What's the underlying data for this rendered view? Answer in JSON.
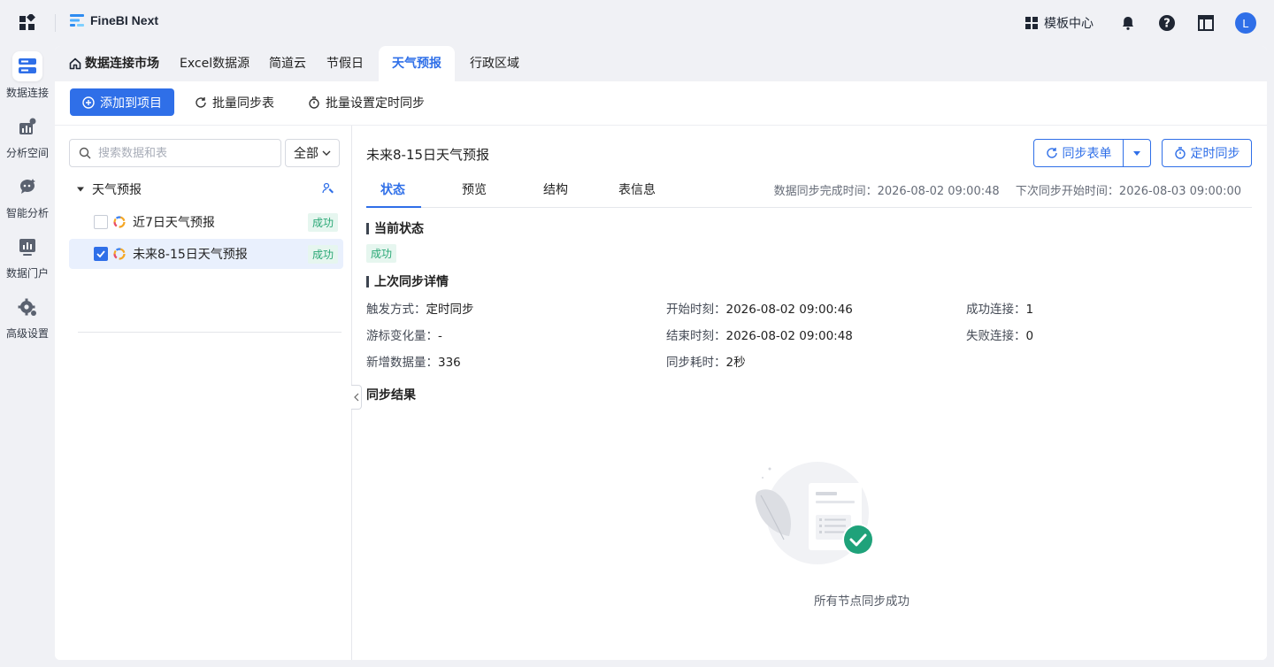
{
  "header": {
    "brand": "FineBI Next",
    "template_center": "模板中心",
    "avatar_letter": "L"
  },
  "leftnav": {
    "items": [
      {
        "label": "数据连接",
        "icon": "data-connection-icon",
        "active": true
      },
      {
        "label": "分析空间",
        "icon": "analysis-space-icon"
      },
      {
        "label": "智能分析",
        "icon": "smart-analysis-icon"
      },
      {
        "label": "数据门户",
        "icon": "data-portal-icon"
      },
      {
        "label": "高级设置",
        "icon": "advanced-settings-icon"
      }
    ]
  },
  "tabs": {
    "home": "数据连接市场",
    "items": [
      "Excel数据源",
      "简道云",
      "节假日",
      "天气预报",
      "行政区域"
    ],
    "active": "天气预报"
  },
  "toolbar": {
    "add_to_project": "添加到项目",
    "batch_sync": "批量同步表",
    "batch_schedule": "批量设置定时同步"
  },
  "tree": {
    "search_placeholder": "搜索数据和表",
    "filter_value": "全部",
    "root_label": "天气预报",
    "rows": [
      {
        "label": "近7日天气预报",
        "status": "成功",
        "checked": false
      },
      {
        "label": "未来8-15日天气预报",
        "status": "成功",
        "checked": true
      }
    ]
  },
  "detail": {
    "title": "未来8-15日天气预报",
    "sync_form_button": "同步表单",
    "timer_sync_button": "定时同步",
    "tabs": [
      "状态",
      "预览",
      "结构",
      "表信息"
    ],
    "sync_done_time": "数据同步完成时间：2026-08-02 09:00:48",
    "next_sync_time": "下次同步开始时间：2026-08-03 09:00:00",
    "current_status_title": "当前状态",
    "current_status": "成功",
    "last_sync_title": "上次同步详情",
    "trigger_label": "触发方式：",
    "trigger_value": "定时同步",
    "start_label": "开始时刻：",
    "start_value": "2026-08-02 09:00:46",
    "success_conn_label": "成功连接：",
    "success_conn_value": "1",
    "cursor_label": "游标变化量：",
    "cursor_value": "-",
    "end_label": "结束时刻：",
    "end_value": "2026-08-02 09:00:48",
    "fail_conn_label": "失败连接：",
    "fail_conn_value": "0",
    "new_rows_label": "新增数据量：",
    "new_rows_value": "336",
    "duration_label": "同步耗时：",
    "duration_value": "2秒",
    "result_title": "同步结果",
    "empty_text": "所有节点同步成功"
  },
  "colors": {
    "primary": "#2f6fe8",
    "success_text": "#2aa876",
    "success_bg": "#e6f6ef",
    "success_illustration": "#1fa27a"
  }
}
